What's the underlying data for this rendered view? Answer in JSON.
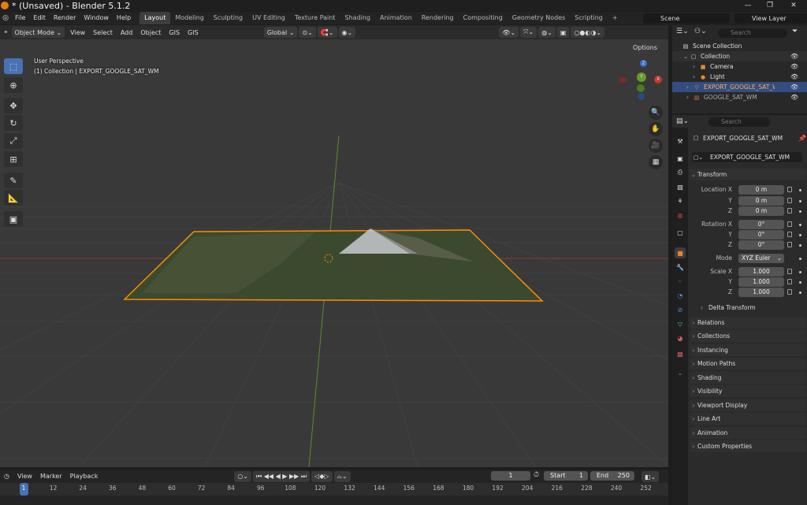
{
  "window": {
    "title": "* (Unsaved) - Blender 5.1.2"
  },
  "menu": [
    "File",
    "Edit",
    "Render",
    "Window",
    "Help"
  ],
  "workspaces": [
    "Layout",
    "Modeling",
    "Sculpting",
    "UV Editing",
    "Texture Paint",
    "Shading",
    "Animation",
    "Rendering",
    "Compositing",
    "Geometry Nodes",
    "Scripting",
    "+"
  ],
  "scene": {
    "scene_name": "Scene",
    "view_layer": "View Layer"
  },
  "viewport": {
    "mode": "Object Mode",
    "menus": [
      "View",
      "Select",
      "Add",
      "Object",
      "GIS",
      "GIS"
    ],
    "orientation": "Global",
    "options_label": "Options",
    "overlay_line1": "User Perspective",
    "overlay_line2": "(1) Collection | EXPORT_GOOGLE_SAT_WM",
    "gizmo": {
      "x": "X",
      "y": "Y",
      "z": "Z"
    }
  },
  "timeline": {
    "menus": [
      "View",
      "Marker",
      "Playback"
    ],
    "current_frame": "1",
    "start_label": "Start",
    "start_value": "1",
    "end_label": "End",
    "end_value": "250",
    "ticks": [
      "1",
      "12",
      "24",
      "36",
      "48",
      "60",
      "72",
      "84",
      "96",
      "108",
      "120",
      "132",
      "144",
      "156",
      "168",
      "180",
      "192",
      "204",
      "216",
      "228",
      "240",
      "252"
    ]
  },
  "outliner": {
    "search_placeholder": "Search",
    "root": "Scene Collection",
    "collection": "Collection",
    "items": [
      "Camera",
      "Light",
      "EXPORT_GOOGLE_SAT_WM",
      "GOOGLE_SAT_WM"
    ]
  },
  "properties": {
    "search_placeholder": "Search",
    "object_name": "EXPORT_GOOGLE_SAT_WM",
    "object_field": "EXPORT_GOOGLE_SAT_WM",
    "transform_label": "Transform",
    "location_label": "Location X",
    "rotation_label": "Rotation X",
    "scale_label": "Scale X",
    "axis_y": "Y",
    "axis_z": "Z",
    "location": [
      "0 m",
      "0 m",
      "0 m"
    ],
    "rotation": [
      "0°",
      "0°",
      "0°"
    ],
    "scale": [
      "1.000",
      "1.000",
      "1.000"
    ],
    "mode_label": "Mode",
    "mode_value": "XYZ Euler",
    "delta_transform": "Delta Transform",
    "sections": [
      "Relations",
      "Collections",
      "Instancing",
      "Motion Paths",
      "Shading",
      "Visibility",
      "Viewport Display",
      "Line Art",
      "Animation",
      "Custom Properties"
    ]
  },
  "colors": {
    "accent": "#4772b3",
    "selection_outline": "#ff8c00",
    "axis_x": "#c0392b",
    "axis_y": "#6a9a2a",
    "axis_z": "#3b6fc9"
  }
}
